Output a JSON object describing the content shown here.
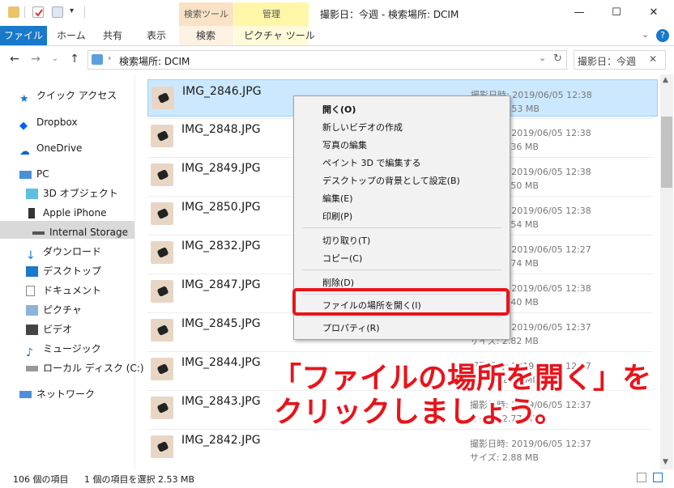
{
  "window": {
    "title": "撮影日：今週 - 検索場所: DCIM",
    "context_tab_search": "検索ツール",
    "context_tab_manage": "管理",
    "minimize": "—",
    "maximize": "☐",
    "close": "✕"
  },
  "ribbon": {
    "file": "ファイル",
    "home": "ホーム",
    "share": "共有",
    "view": "表示",
    "search": "検索",
    "picture_tools": "ピクチャ ツール"
  },
  "address": {
    "path": "検索場所: DCIM",
    "search_value": "撮影日：今週"
  },
  "sidebar": {
    "items": [
      {
        "label": "クイック アクセス"
      },
      {
        "label": "Dropbox"
      },
      {
        "label": "OneDrive"
      },
      {
        "label": "PC"
      },
      {
        "label": "3D オブジェクト"
      },
      {
        "label": "Apple iPhone"
      },
      {
        "label": "Internal Storage"
      },
      {
        "label": "ダウンロード"
      },
      {
        "label": "デスクトップ"
      },
      {
        "label": "ドキュメント"
      },
      {
        "label": "ピクチャ"
      },
      {
        "label": "ビデオ"
      },
      {
        "label": "ミュージック"
      },
      {
        "label": "ローカル ディスク (C:)"
      },
      {
        "label": "ネットワーク"
      }
    ]
  },
  "files": [
    {
      "name": "IMG_2846.JPG",
      "date": "撮影日時: 2019/06/05 12:38",
      "size": "サイズ: 2.53 MB"
    },
    {
      "name": "IMG_2848.JPG",
      "date": "撮影日時: 2019/06/05 12:38",
      "size": "サイズ: 2.36 MB"
    },
    {
      "name": "IMG_2849.JPG",
      "date": "撮影日時: 2019/06/05 12:38",
      "size": "サイズ: 2.50 MB"
    },
    {
      "name": "IMG_2850.JPG",
      "date": "撮影日時: 2019/06/05 12:38",
      "size": "サイズ: 2.54 MB"
    },
    {
      "name": "IMG_2832.JPG",
      "date": "撮影日時: 2019/06/05 12:27",
      "size": "サイズ: 2.74 MB"
    },
    {
      "name": "IMG_2847.JPG",
      "date": "撮影日時: 2019/06/05 12:38",
      "size": "サイズ: 2.40 MB"
    },
    {
      "name": "IMG_2845.JPG",
      "date": "撮影日時: 2019/06/05 12:37",
      "size": "サイズ: 2.82 MB"
    },
    {
      "name": "IMG_2844.JPG",
      "date": "撮影日時: 2019/06/05 12:37",
      "size": "サイズ: 2.71 MB"
    },
    {
      "name": "IMG_2843.JPG",
      "date": "撮影日時: 2019/06/05 12:37",
      "size": "サイズ: 2.77 MB"
    },
    {
      "name": "IMG_2842.JPG",
      "date": "撮影日時: 2019/06/05 12:37",
      "size": "サイズ: 2.88 MB"
    }
  ],
  "context_menu": {
    "open": "開く(O)",
    "new_video": "新しいビデオの作成",
    "edit_photo": "写真の編集",
    "paint3d": "ペイント 3D で編集する",
    "set_background": "デスクトップの背景として設定(B)",
    "edit": "編集(E)",
    "print": "印刷(P)",
    "cut": "切り取り(T)",
    "copy": "コピー(C)",
    "delete": "削除(D)",
    "open_location": "ファイルの場所を開く(I)",
    "properties": "プロパティ(R)"
  },
  "annotation": {
    "line1": "「ファイルの場所を開く」を",
    "line2": "クリックしましょう。"
  },
  "status": {
    "count": "106 個の項目",
    "selected": "1 個の項目を選択  2.53 MB"
  },
  "colors": {
    "accent": "#1979ca",
    "selection": "#cce8ff",
    "annotation": "#e8141b"
  }
}
